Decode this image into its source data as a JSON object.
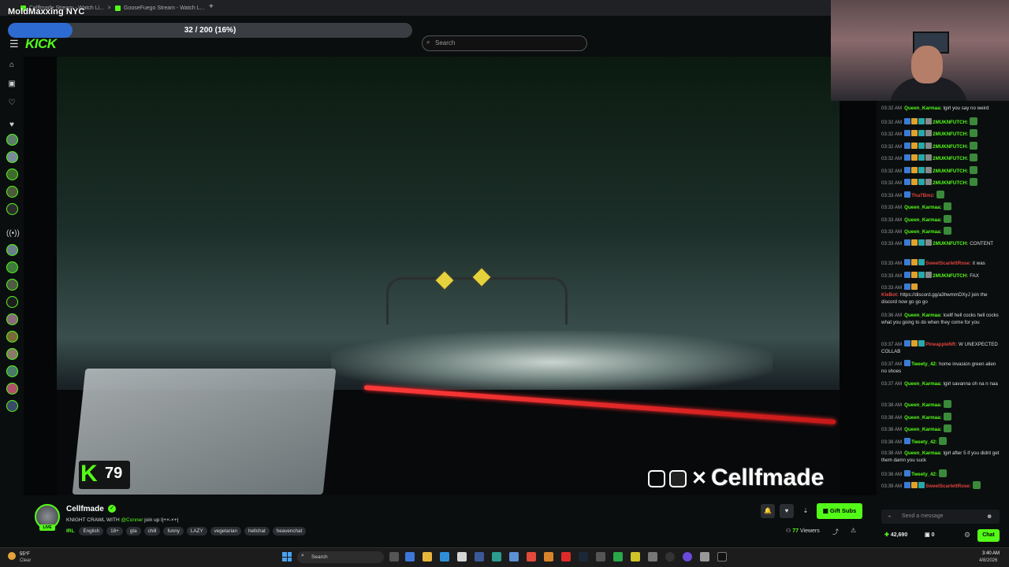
{
  "browser": {
    "tabs": [
      {
        "label": "Cellfmade Stream - Watch Li..."
      },
      {
        "label": "GooseFuego Stream - Watch L..."
      }
    ],
    "new_tab": "+"
  },
  "overlay": {
    "title": "MoldMaxxing NYC",
    "progress_text": "32 / 200 (16%)",
    "progress_fraction": 0.16
  },
  "header": {
    "logo": "KICK",
    "search_placeholder": "Search"
  },
  "video": {
    "badge_number": "79",
    "badge_k": "K",
    "watermark": "Cellfmade"
  },
  "chat": {
    "messages": [
      {
        "time": "03:32 AM",
        "user": "Queen_Karmaa:",
        "color": "#53fc18",
        "text": "lgirl you say no weird",
        "badges": 0
      },
      {
        "time": "03:32 AM",
        "user": "2MUKNFUTCH:",
        "color": "#53fc18",
        "text": "",
        "badges": 4,
        "emote": true
      },
      {
        "time": "03:32 AM",
        "user": "2MUKNFUTCH:",
        "color": "#53fc18",
        "text": "",
        "badges": 4,
        "emote": true
      },
      {
        "time": "03:32 AM",
        "user": "2MUKNFUTCH:",
        "color": "#53fc18",
        "text": "",
        "badges": 4,
        "emote": true
      },
      {
        "time": "03:32 AM",
        "user": "2MUKNFUTCH:",
        "color": "#53fc18",
        "text": "",
        "badges": 4,
        "emote": true
      },
      {
        "time": "03:32 AM",
        "user": "2MUKNFUTCH:",
        "color": "#53fc18",
        "text": "",
        "badges": 4,
        "emote": true
      },
      {
        "time": "03:32 AM",
        "user": "2MUKNFUTCH:",
        "color": "#53fc18",
        "text": "",
        "badges": 4,
        "emote": true
      },
      {
        "time": "03:33 AM",
        "user": "Tha7Bmz:",
        "color": "#e0433d",
        "text": "",
        "badges": 1,
        "emote": true
      },
      {
        "time": "03:33 AM",
        "user": "Queen_Karmaa:",
        "color": "#53fc18",
        "text": "",
        "badges": 0,
        "emote": true
      },
      {
        "time": "03:33 AM",
        "user": "Queen_Karmaa:",
        "color": "#53fc18",
        "text": "",
        "badges": 0,
        "emote": true
      },
      {
        "time": "03:33 AM",
        "user": "Queen_Karmaa:",
        "color": "#53fc18",
        "text": "",
        "badges": 0,
        "emote": true
      },
      {
        "time": "03:33 AM",
        "user": "2MUKNFUTCH:",
        "color": "#53fc18",
        "text": "CONTENT",
        "badges": 4
      },
      {
        "time": "03:33 AM",
        "user": "SweetScarlettRose:",
        "color": "#e0433d",
        "text": "it was",
        "badges": 3
      },
      {
        "time": "03:33 AM",
        "user": "2MUKNFUTCH:",
        "color": "#53fc18",
        "text": "FAX",
        "badges": 4
      },
      {
        "time": "03:33 AM",
        "user": "KleBot:",
        "color": "#e0433d",
        "text": "https://discord.gg/a3hwmmDXyJ join the discord now go go go",
        "badges": 2
      },
      {
        "time": "03:36 AM",
        "user": "Queen_Karmaa:",
        "color": "#53fc18",
        "text": "lcellf hell cocks hell cocks what you going to do when they come for you",
        "badges": 0
      },
      {
        "time": "03:37 AM",
        "user": "PineappleNft:",
        "color": "#e0433d",
        "text": "W UNEXPECTED COLLAB",
        "badges": 3
      },
      {
        "time": "03:37 AM",
        "user": "Tweety_42:",
        "color": "#53fc18",
        "text": "home invasion green alien no shoes",
        "badges": 1
      },
      {
        "time": "03:37 AM",
        "user": "Queen_Karmaa:",
        "color": "#53fc18",
        "text": "lgirl savanna oh na n naa",
        "badges": 0
      },
      {
        "time": "03:38 AM",
        "user": "Queen_Karmaa:",
        "color": "#53fc18",
        "text": "",
        "badges": 0,
        "emote": true
      },
      {
        "time": "03:38 AM",
        "user": "Queen_Karmaa:",
        "color": "#53fc18",
        "text": "",
        "badges": 0,
        "emote": true
      },
      {
        "time": "03:38 AM",
        "user": "Queen_Karmaa:",
        "color": "#53fc18",
        "text": "",
        "badges": 0,
        "emote": true
      },
      {
        "time": "03:38 AM",
        "user": "Tweety_42:",
        "color": "#53fc18",
        "text": "",
        "badges": 1,
        "emote": true
      },
      {
        "time": "03:38 AM",
        "user": "Queen_Karmaa:",
        "color": "#53fc18",
        "text": "lgirl after 5 if you didnt get them damn you suck",
        "badges": 0
      },
      {
        "time": "03:38 AM",
        "user": "Tweety_42:",
        "color": "#53fc18",
        "text": "",
        "badges": 1,
        "emote": true
      },
      {
        "time": "03:39 AM",
        "user": "SweetScarlettRose:",
        "color": "#e0433d",
        "text": "",
        "badges": 3,
        "emote": true
      }
    ],
    "input_placeholder": "Send a message",
    "points": "42,690",
    "count_zero": "0",
    "chat_button": "Chat"
  },
  "channel": {
    "name": "Cellfmade",
    "live_label": "LIVE",
    "title_prefix": "KNIGHT CRAWL WITH ",
    "title_mention": "@Conner",
    "title_suffix": " join up l|+×-×+|",
    "category": "IRL",
    "tags": [
      "English",
      "18+",
      "gta",
      "chill",
      "funny",
      "LAZY",
      "vegetarian",
      "hellchat",
      "heavenchat"
    ],
    "gift_label": "Gift Subs",
    "viewers_count": "77",
    "viewers_label": "Viewers"
  },
  "taskbar": {
    "temp": "55°F",
    "weather": "Clear",
    "search": "Search",
    "time": "3:40 AM",
    "date": "4/8/2026"
  },
  "colors": {
    "kick_green": "#53fc18",
    "progress_blue": "#2e6bd1",
    "chat_red": "#e0433d"
  }
}
